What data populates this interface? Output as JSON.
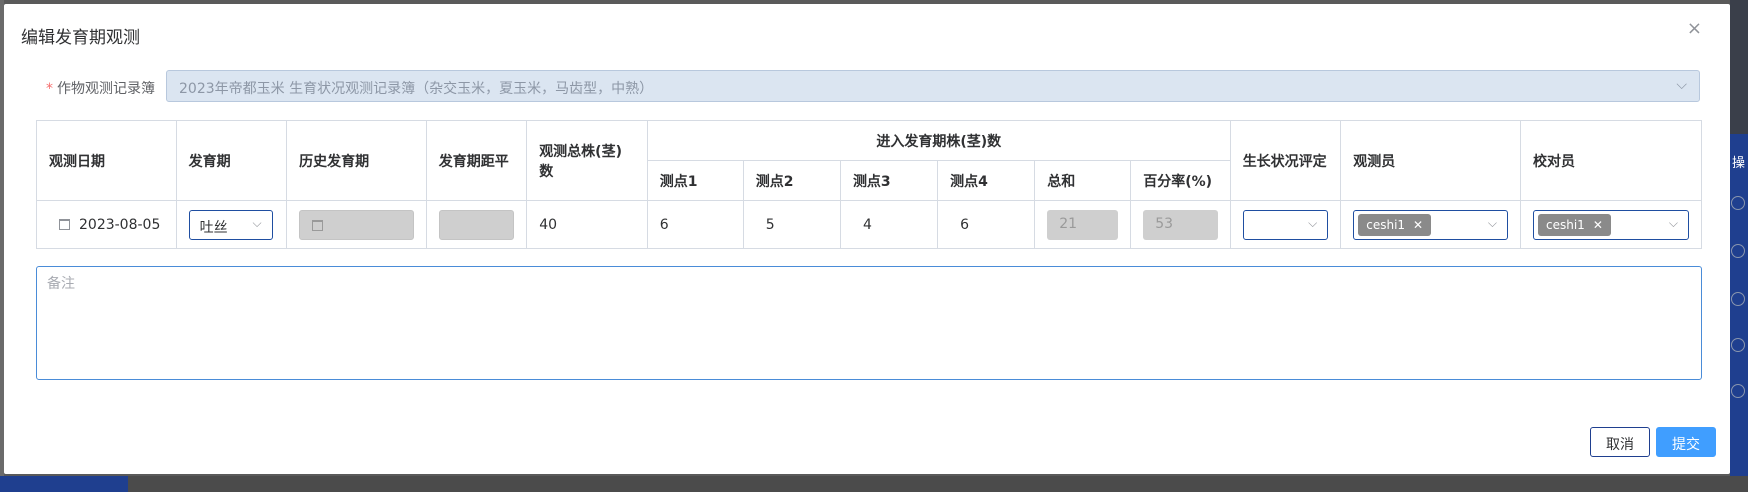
{
  "dialog": {
    "title": "编辑发育期观测",
    "close_glyph": "×"
  },
  "form": {
    "book_label": "作物观测记录簿",
    "required_mark": "*",
    "book_value": "2023年帝都玉米 生育状况观测记录簿（杂交玉米，夏玉米，马齿型，中熟）"
  },
  "table": {
    "headers": {
      "obs_date": "观测日期",
      "stage": "发育期",
      "history_stage": "历史发育期",
      "stage_anomaly": "发育期距平",
      "total_plants": "观测总株(茎)数",
      "entered_group": "进入发育期株(茎)数",
      "point1": "测点1",
      "point2": "测点2",
      "point3": "测点3",
      "point4": "测点4",
      "sum": "总和",
      "percent": "百分率(%)",
      "growth_rating": "生长状况评定",
      "observer": "观测员",
      "proofreader": "校对员"
    },
    "row": {
      "obs_date": "2023-08-05",
      "stage": "吐丝",
      "total_plants": "40",
      "point1": "6",
      "point2": "5",
      "point3": "4",
      "point4": "6",
      "sum": "21",
      "percent": "53",
      "observer_tag": "ceshi1",
      "proofreader_tag": "ceshi1"
    }
  },
  "remark": {
    "placeholder": "备注"
  },
  "buttons": {
    "cancel": "取消",
    "submit": "提交"
  },
  "background": {
    "side_glyph": "操"
  }
}
